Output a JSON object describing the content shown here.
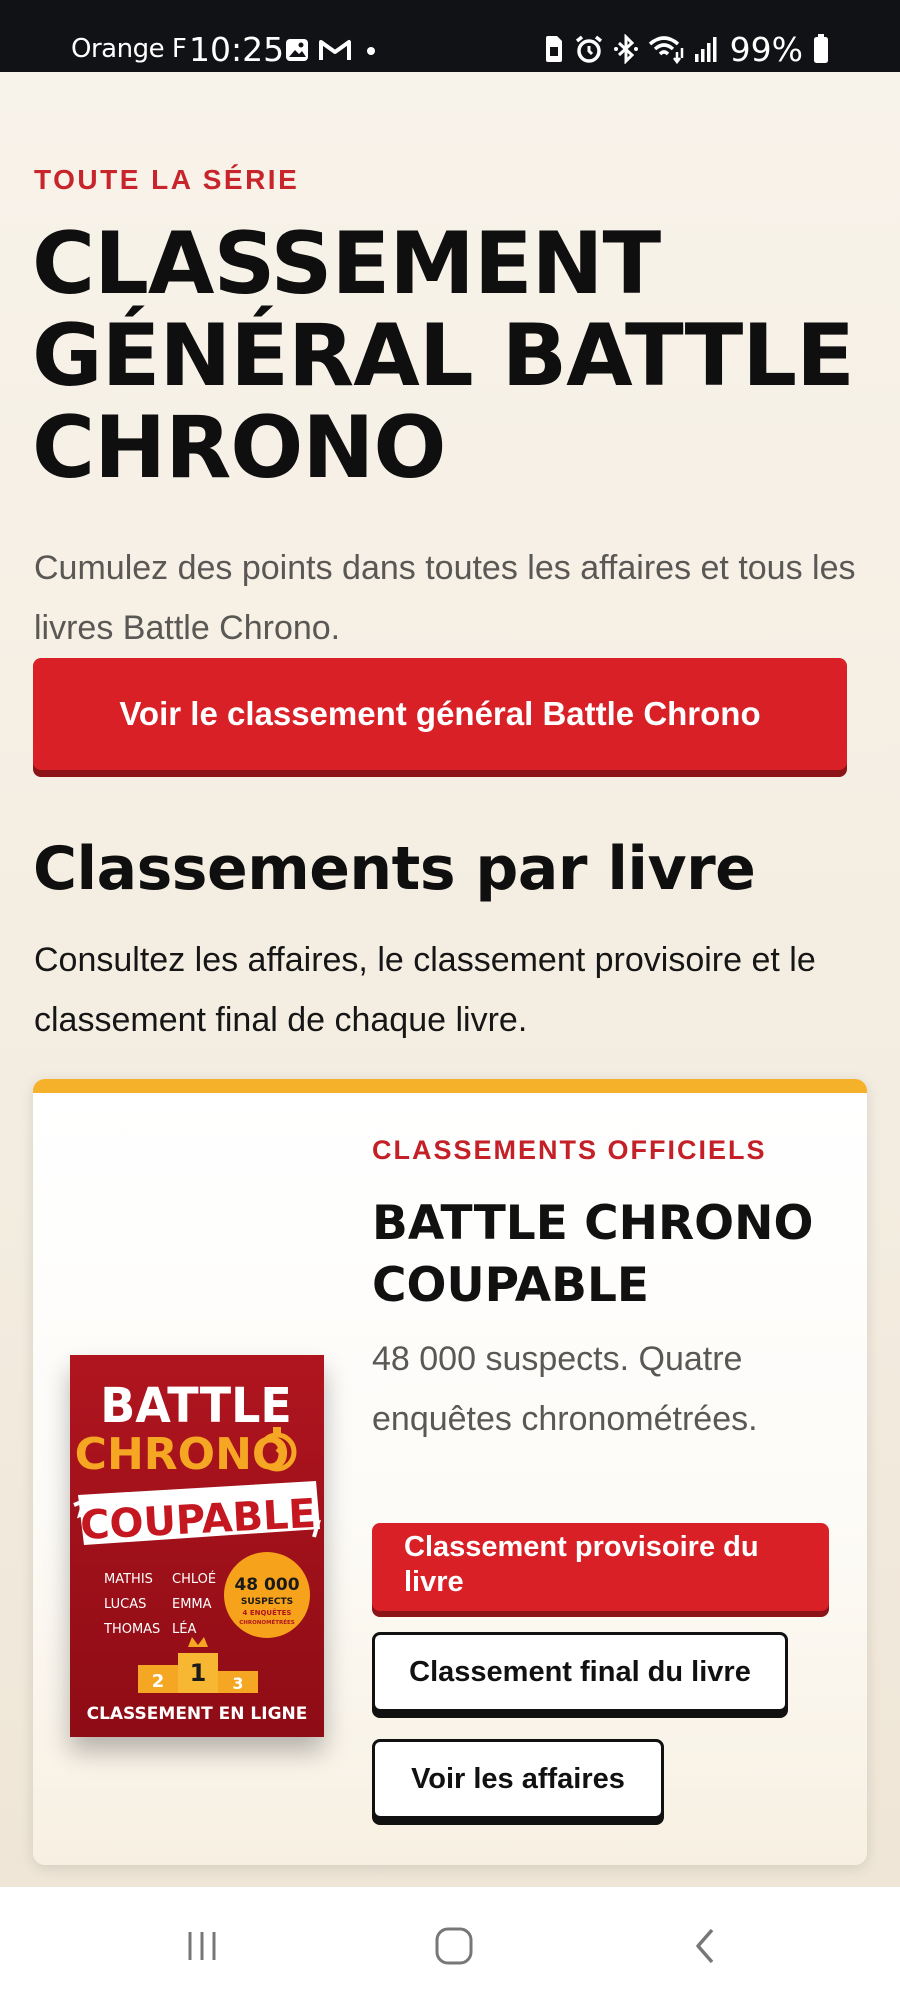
{
  "status_bar": {
    "carrier": "Orange F",
    "time": "10:25",
    "battery": "99%",
    "left_icons": [
      "image-icon",
      "gmail-icon",
      "dot-icon"
    ],
    "right_icons": [
      "sim-icon",
      "alarm-icon",
      "bluetooth-icon",
      "wifi-icon",
      "signal-icon",
      "battery-icon"
    ]
  },
  "hero": {
    "eyebrow": "TOUTE LA SÉRIE",
    "title": "CLASSEMENT GÉNÉRAL BATTLE CHRONO",
    "subtitle": "Cumulez des points dans toutes les affaires et tous les livres Battle Chrono.",
    "cta_label": "Voir le classement général Battle Chrono"
  },
  "books_section": {
    "title": "Classements par livre",
    "description": "Consultez les affaires, le classement provisoire et le classement final de chaque livre."
  },
  "book_card": {
    "eyebrow": "CLASSEMENTS OFFICIELS",
    "title": "BATTLE CHRONO COUPABLE",
    "description": "48 000 suspects. Quatre enquêtes chronométrées.",
    "buttons": {
      "provisional": "Classement provisoire du livre",
      "final": "Classement final du livre",
      "cases": "Voir les affaires"
    },
    "cover": {
      "line1": "BATTLE",
      "line2": "CHRONO",
      "banner": "COUPABLE",
      "names_left": [
        "MATHIS",
        "LUCAS",
        "THOMAS"
      ],
      "names_right": [
        "CHLOÉ",
        "EMMA",
        "LÉA"
      ],
      "badge_number": "48 000",
      "badge_line1": "SUSPECTS",
      "badge_line2": "4 ENQUÊTES",
      "badge_line3": "CHRONOMÉTRÉES",
      "podium": [
        "2",
        "1",
        "3"
      ],
      "footer": "CLASSEMENT EN LIGNE"
    }
  },
  "colors": {
    "accent_red": "#d92027",
    "card_top_border": "#f6b12a",
    "background": "#f6efe3"
  },
  "nav_bar": {
    "icons": [
      "recent-apps-icon",
      "home-icon",
      "back-icon"
    ]
  }
}
